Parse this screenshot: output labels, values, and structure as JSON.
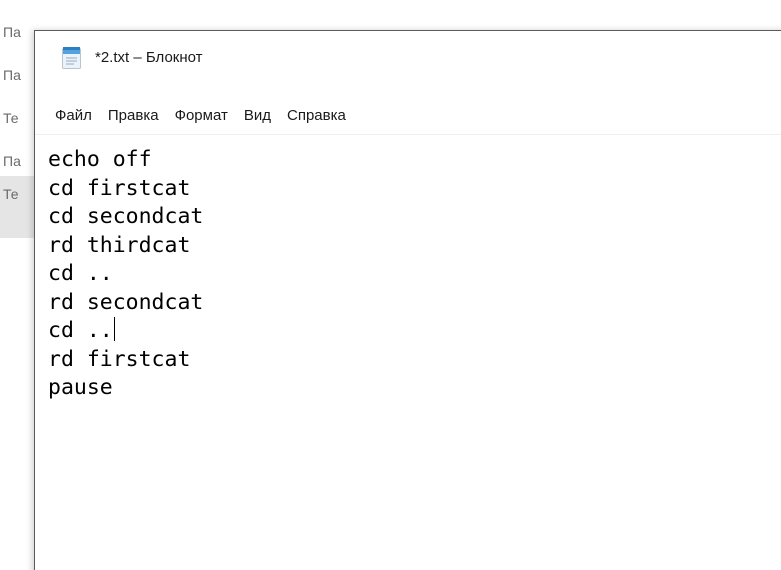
{
  "background_window": {
    "items": [
      {
        "label": "Па",
        "selected": false
      },
      {
        "label": "Па",
        "selected": false
      },
      {
        "label": "Те",
        "selected": false
      },
      {
        "label": "Па",
        "selected": false
      },
      {
        "label": "Те",
        "selected": true
      }
    ]
  },
  "notepad": {
    "title": "*2.txt – Блокнот",
    "menu": [
      {
        "label": "Файл"
      },
      {
        "label": "Правка"
      },
      {
        "label": "Формат"
      },
      {
        "label": "Вид"
      },
      {
        "label": "Справка"
      }
    ],
    "lines": [
      "echo off",
      "cd firstcat",
      "cd secondcat",
      "rd thirdcat",
      "cd ..",
      "rd secondcat",
      "cd ..",
      "rd firstcat",
      "pause"
    ],
    "caret_line": 6,
    "icon": "notepad-icon"
  }
}
